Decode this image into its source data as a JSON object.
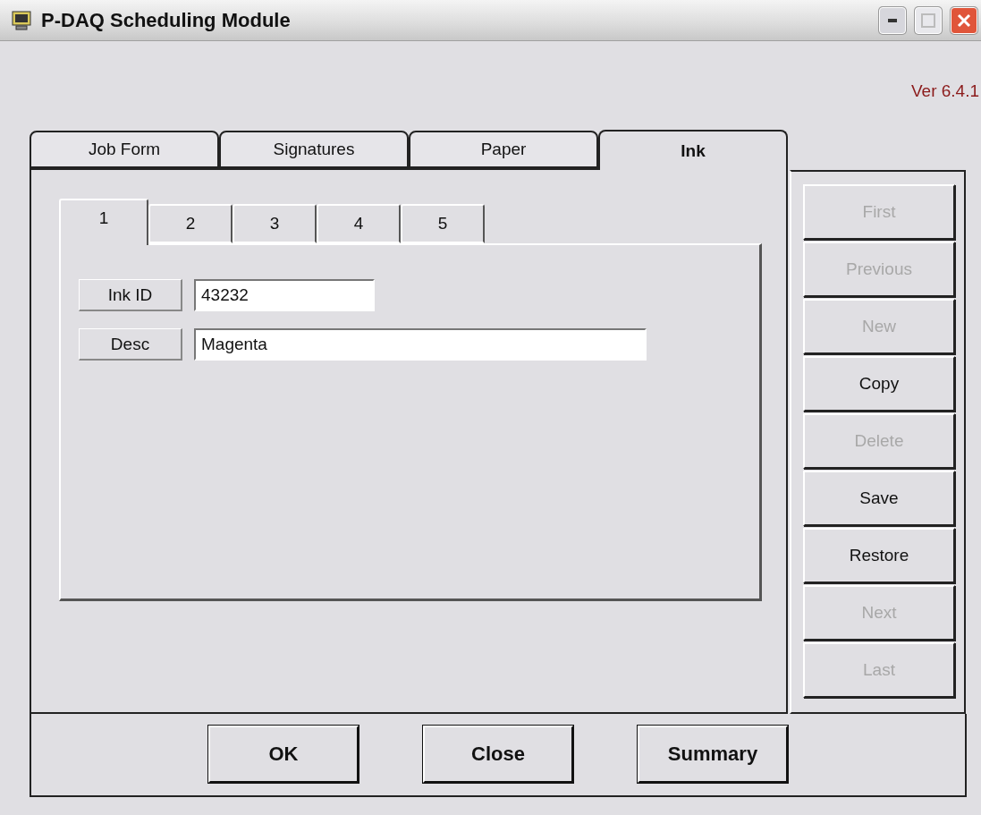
{
  "window": {
    "title": "P-DAQ Scheduling Module"
  },
  "version": "Ver 6.4.1",
  "tabs": [
    {
      "label": "Job Form",
      "selected": false
    },
    {
      "label": "Signatures",
      "selected": false
    },
    {
      "label": "Paper",
      "selected": false
    },
    {
      "label": "Ink",
      "selected": true
    }
  ],
  "subtabs": [
    {
      "label": "1",
      "selected": true
    },
    {
      "label": "2",
      "selected": false
    },
    {
      "label": "3",
      "selected": false
    },
    {
      "label": "4",
      "selected": false
    },
    {
      "label": "5",
      "selected": false
    }
  ],
  "fields": [
    {
      "label": "Ink ID",
      "value": "43232",
      "kind": "short"
    },
    {
      "label": "Desc",
      "value": "Magenta",
      "kind": "long"
    }
  ],
  "side_buttons": [
    {
      "label": "First",
      "disabled": true
    },
    {
      "label": "Previous",
      "disabled": true
    },
    {
      "label": "New",
      "disabled": true
    },
    {
      "label": "Copy",
      "disabled": false
    },
    {
      "label": "Delete",
      "disabled": true
    },
    {
      "label": "Save",
      "disabled": false
    },
    {
      "label": "Restore",
      "disabled": false
    },
    {
      "label": "Next",
      "disabled": true
    },
    {
      "label": "Last",
      "disabled": true
    }
  ],
  "footer_buttons": [
    "OK",
    "Close",
    "Summary"
  ]
}
